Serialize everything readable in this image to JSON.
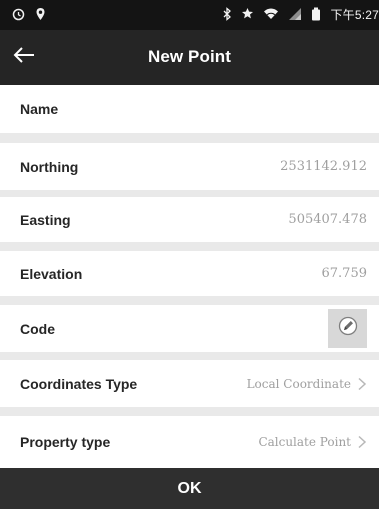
{
  "status_bar": {
    "left_icons": [
      "alarm-icon",
      "location-pin-icon"
    ],
    "right_icons": [
      "bluetooth-icon",
      "star-icon",
      "wifi-icon",
      "signal-icon",
      "battery-icon"
    ],
    "time": "下午5:27"
  },
  "header": {
    "title": "New Point",
    "back_icon": "back-arrow-icon"
  },
  "form": {
    "name": {
      "label": "Name",
      "value": ""
    },
    "northing": {
      "label": "Northing",
      "value": "2531142.912"
    },
    "easting": {
      "label": "Easting",
      "value": "505407.478"
    },
    "elevation": {
      "label": "Elevation",
      "value": "67.759"
    },
    "code": {
      "label": "Code",
      "value": "",
      "button_icon": "pen-edit-icon"
    },
    "coordinates_type": {
      "label": "Coordinates Type",
      "value": "Local Coordinate",
      "icon": "chevron-right-icon"
    },
    "property_type": {
      "label": "Property type",
      "value": "Calculate Point",
      "icon": "chevron-right-icon"
    }
  },
  "actions": {
    "ok_label": "OK"
  },
  "colors": {
    "status_bar_bg": "#141414",
    "header_bg": "#252525",
    "page_bg": "#e9e9e9",
    "row_bg": "#ffffff",
    "button_bg": "#2f2f2f",
    "value_text": "#9f9f9f"
  }
}
